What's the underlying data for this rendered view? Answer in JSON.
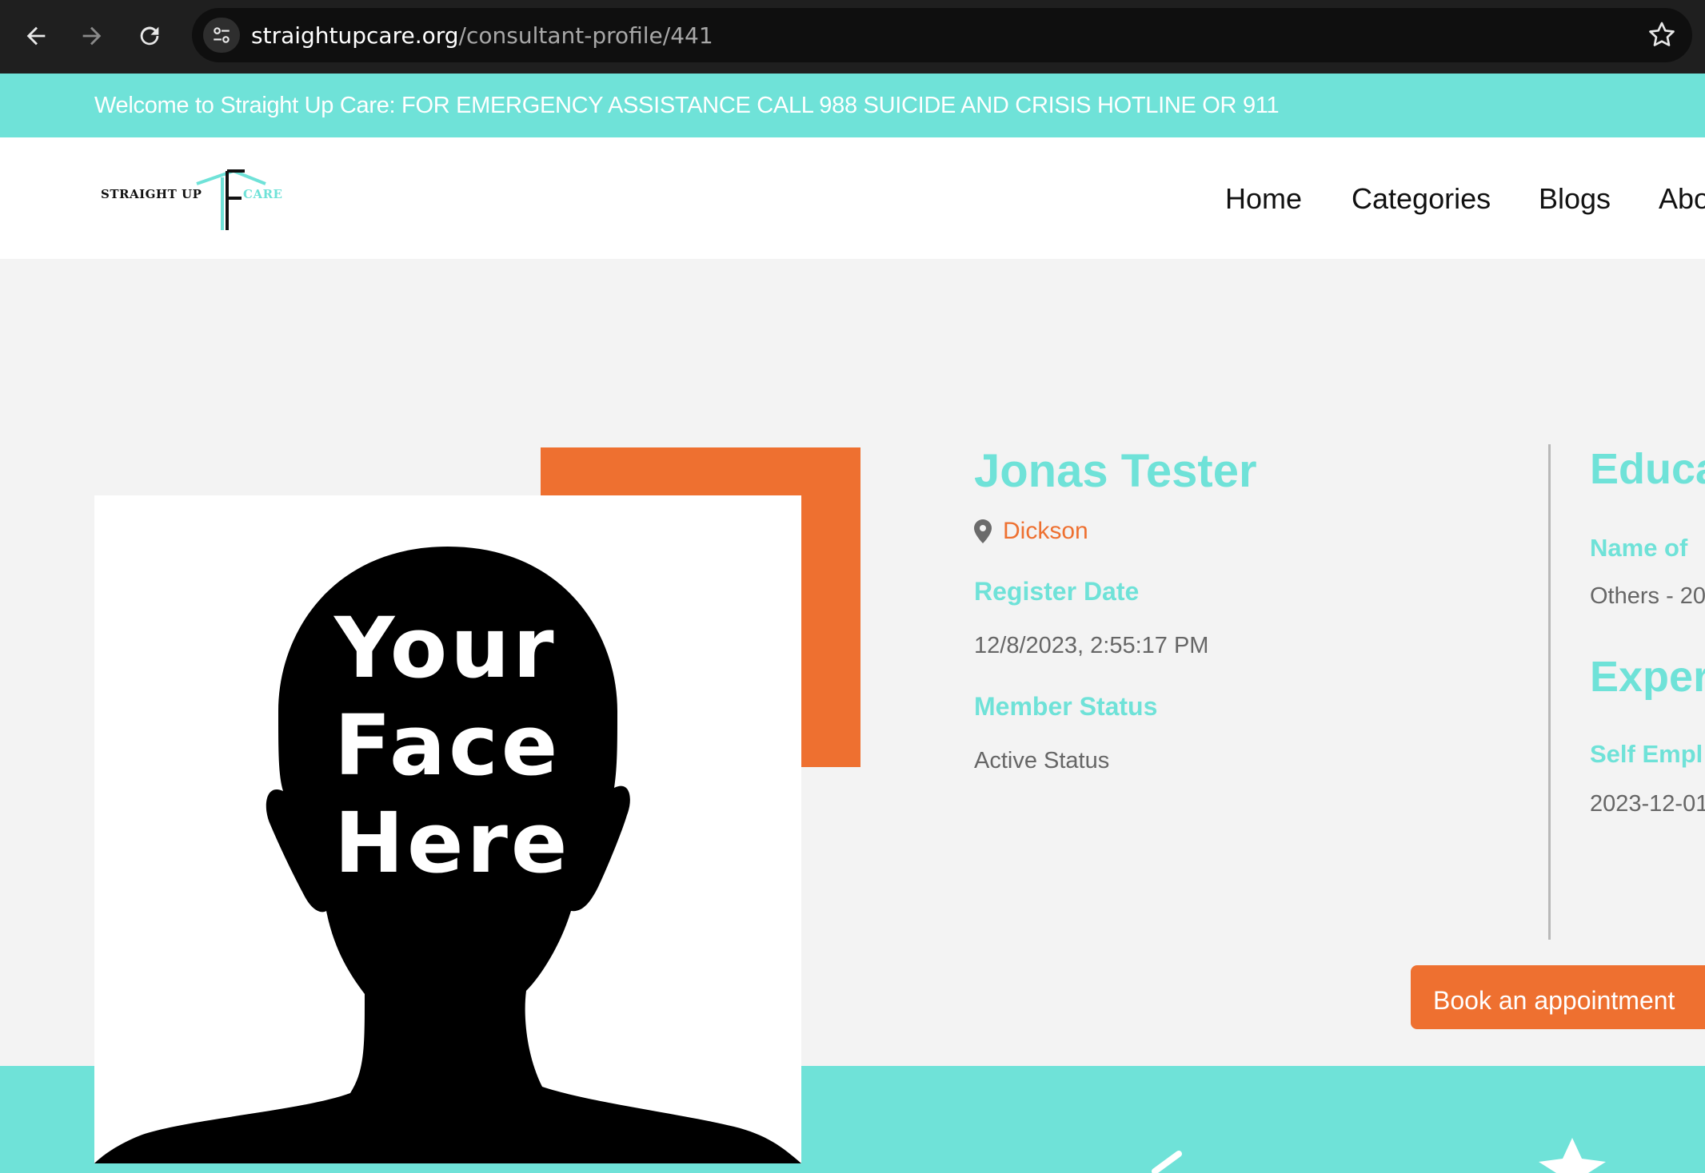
{
  "browser": {
    "url_domain": "straightupcare.org",
    "url_path": "/consultant-profile/441",
    "icons": [
      "back-icon",
      "forward-icon",
      "reload-icon",
      "site-settings-icon",
      "bookmark-star-icon"
    ]
  },
  "announcement": "Welcome to Straight Up Care: FOR EMERGENCY ASSISTANCE CALL 988 SUICIDE AND CRISIS HOTLINE OR 911",
  "logo": {
    "left_text": "STRAIGHT UP",
    "right_text": "CARE"
  },
  "nav": {
    "home": "Home",
    "categories": "Categories",
    "blogs": "Blogs",
    "about": "Abo"
  },
  "photo": {
    "line1": "Your",
    "line2": "Face",
    "line3": "Here"
  },
  "profile": {
    "name": "Jonas Tester",
    "location": "Dickson",
    "register_label": "Register Date",
    "register_value": "12/8/2023, 2:55:17 PM",
    "status_label": "Member Status",
    "status_value": "Active Status"
  },
  "education": {
    "heading": "Educa",
    "label": "Name of",
    "value": "Others - 20"
  },
  "experience": {
    "heading": "Experi",
    "label": "Self Empl",
    "value": "2023-12-01"
  },
  "book_button": "Book an appointment",
  "colors": {
    "teal": "#6fe2d8",
    "orange": "#ee7030",
    "chrome": "#1f1f1f"
  }
}
